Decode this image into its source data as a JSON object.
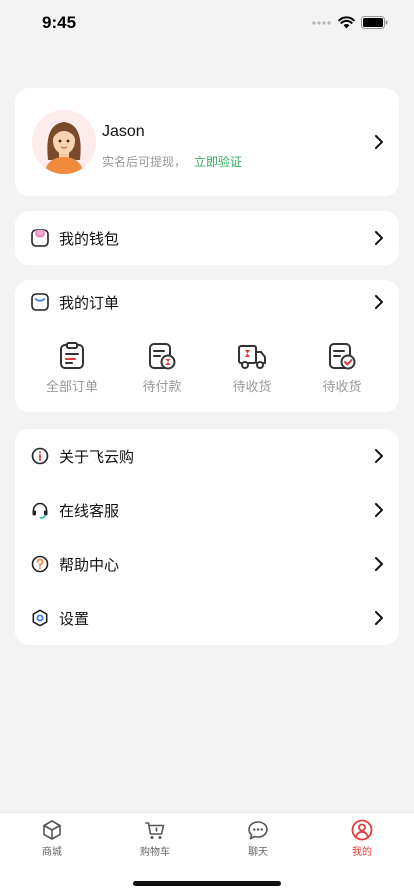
{
  "status_bar": {
    "time": "9:45"
  },
  "profile": {
    "name": "Jason",
    "hint": "实名后可提现，",
    "verify_link": "立即验证"
  },
  "wallet": {
    "label": "我的钱包"
  },
  "orders": {
    "title": "我的订单",
    "items": [
      {
        "label": "全部订单",
        "icon": "clipboard-icon"
      },
      {
        "label": "待付款",
        "icon": "payment-pending-icon"
      },
      {
        "label": "待收货",
        "icon": "delivery-truck-icon"
      },
      {
        "label": "待收货",
        "icon": "received-check-icon"
      }
    ]
  },
  "menu": {
    "items": [
      {
        "label": "关于飞云购",
        "icon": "info-icon"
      },
      {
        "label": "在线客服",
        "icon": "headset-icon"
      },
      {
        "label": "帮助中心",
        "icon": "help-icon"
      },
      {
        "label": "设置",
        "icon": "settings-icon"
      }
    ]
  },
  "tab_bar": {
    "tabs": [
      {
        "label": "商城",
        "icon": "box-icon",
        "active": false
      },
      {
        "label": "购物车",
        "icon": "cart-icon",
        "active": false
      },
      {
        "label": "聊天",
        "icon": "chat-icon",
        "active": false
      },
      {
        "label": "我的",
        "icon": "user-icon",
        "active": true
      }
    ]
  },
  "colors": {
    "background": "#f3f3f3",
    "accent_red": "#e03b3b",
    "verify_green": "#2fb15d",
    "muted_text": "#999999"
  }
}
